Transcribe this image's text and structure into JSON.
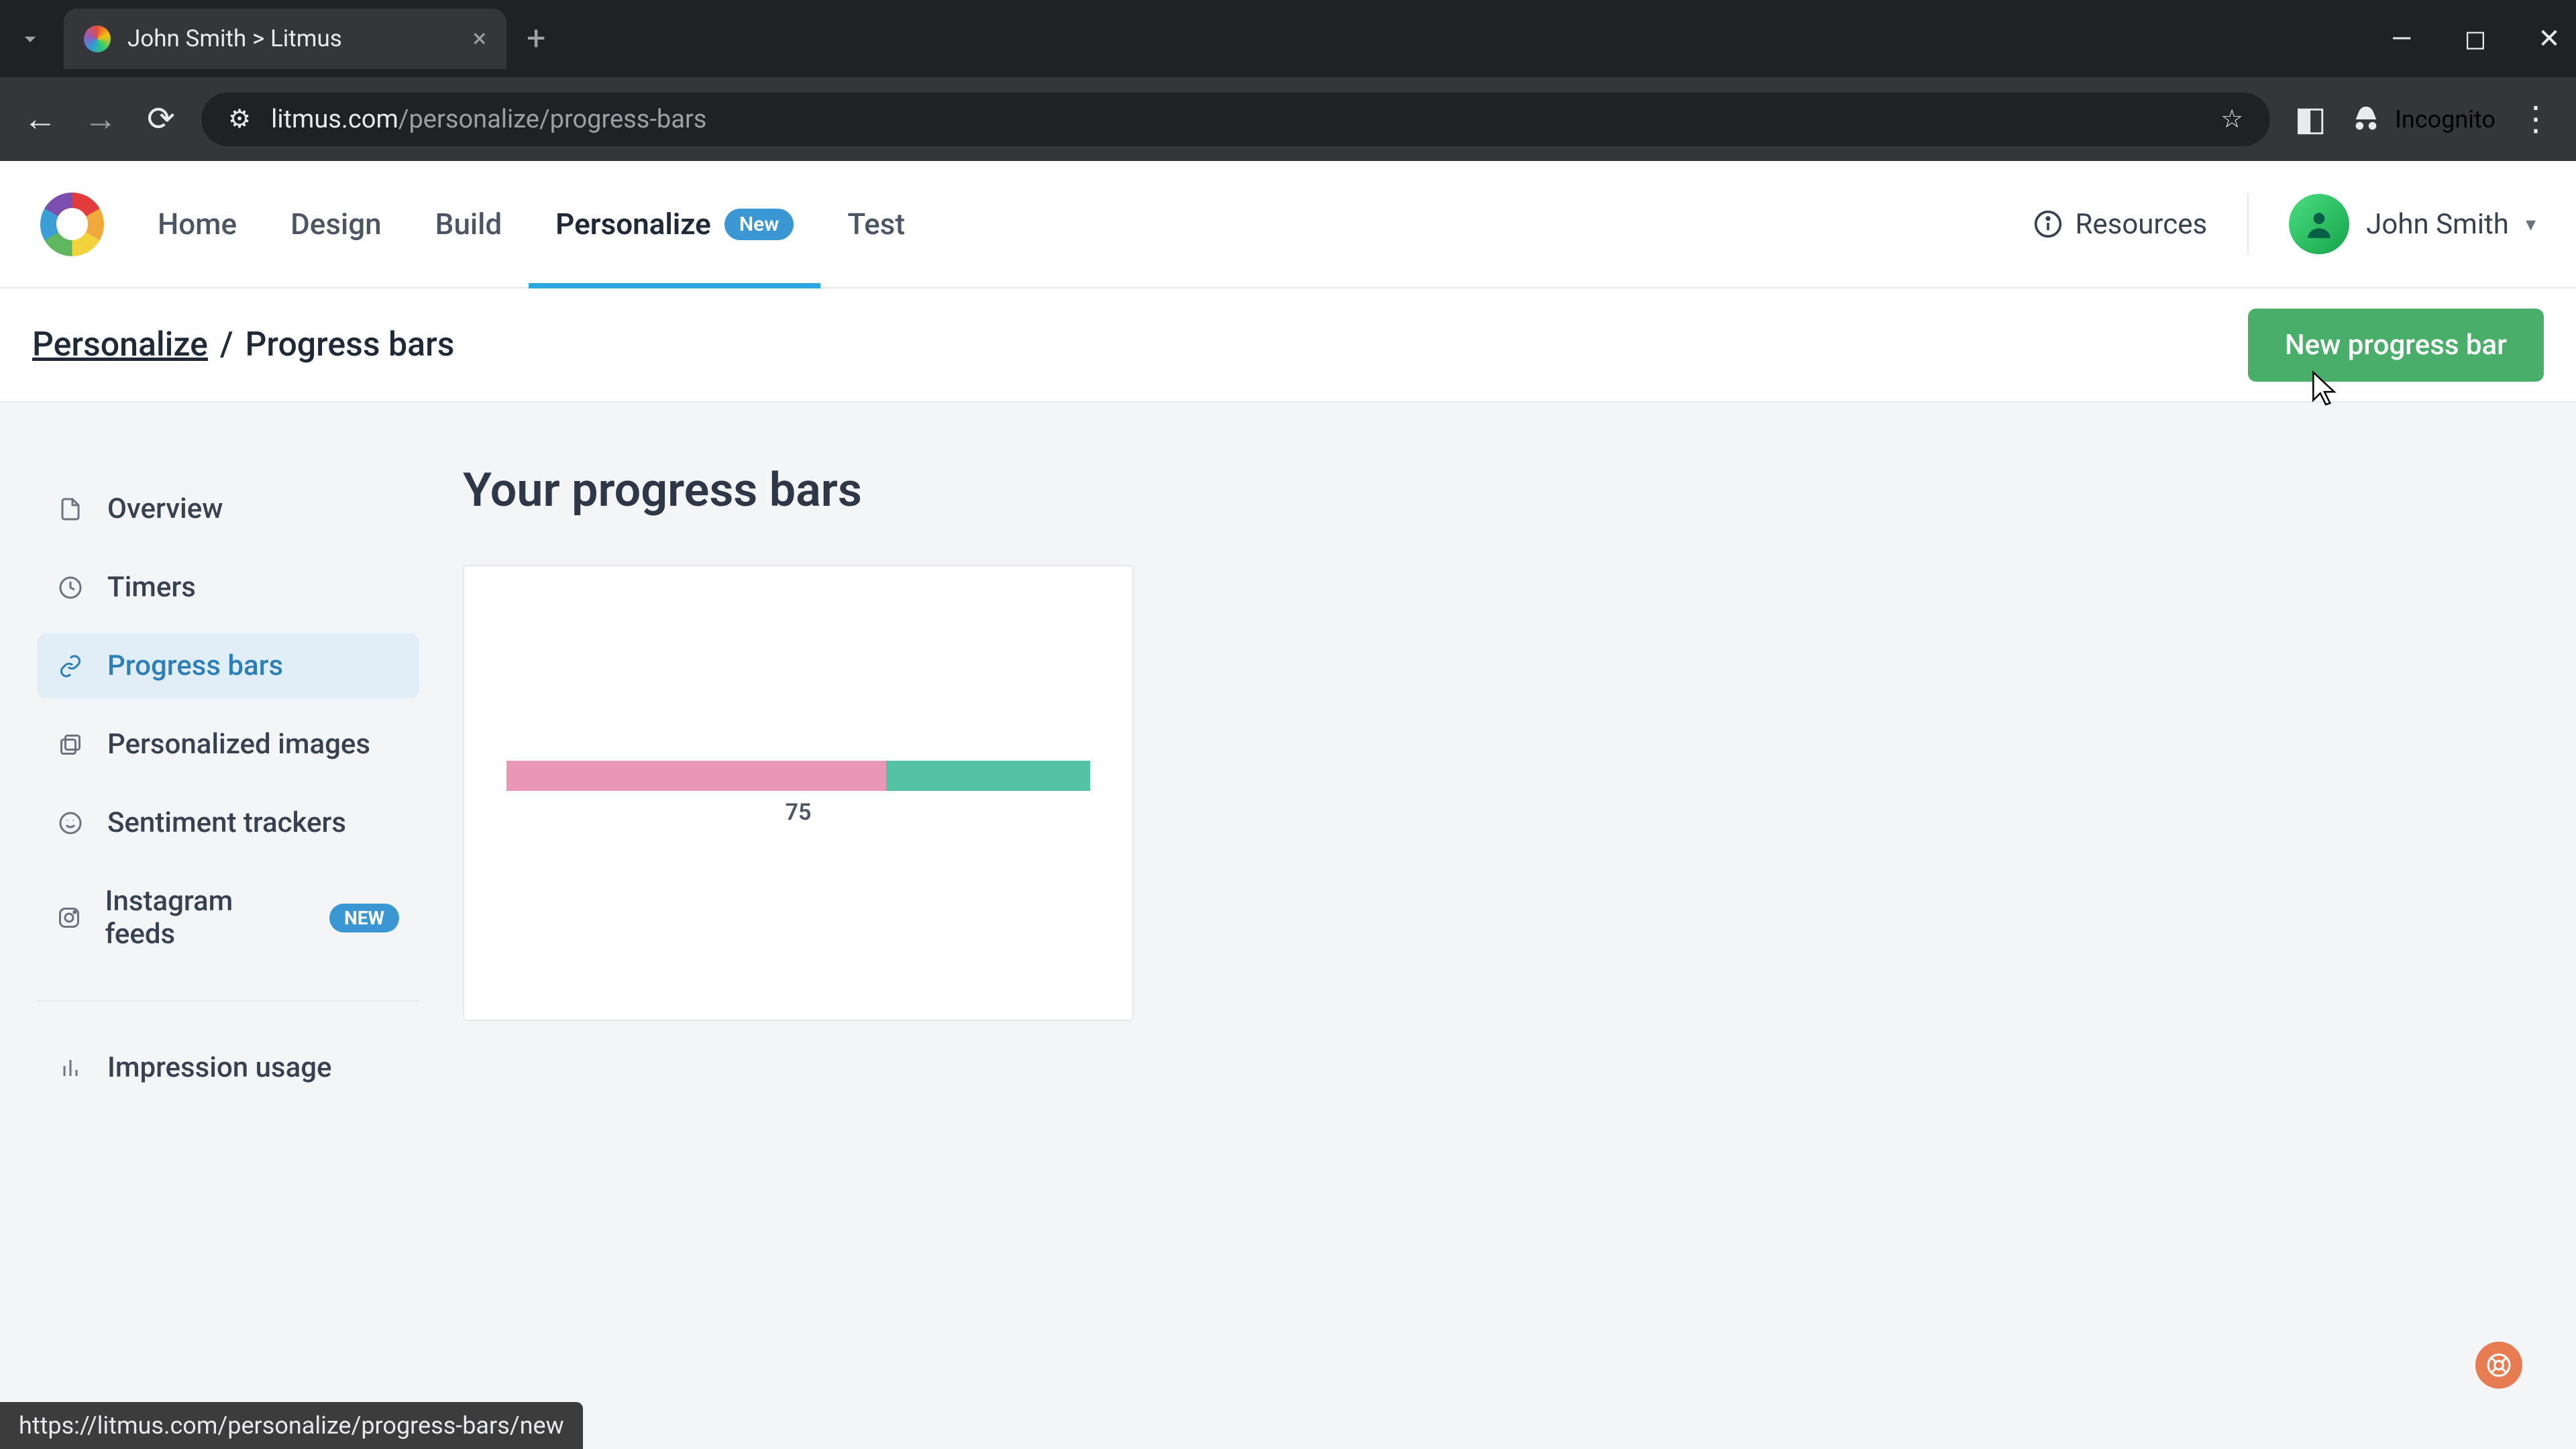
{
  "browser": {
    "tab_title": "John Smith > Litmus",
    "url_host": "litmus.com",
    "url_path": "/personalize/progress-bars",
    "incognito_label": "Incognito",
    "status_url": "https://litmus.com/personalize/progress-bars/new"
  },
  "header": {
    "nav": {
      "home": "Home",
      "design": "Design",
      "build": "Build",
      "personalize": "Personalize",
      "personalize_badge": "New",
      "test": "Test"
    },
    "resources": "Resources",
    "user_name": "John Smith"
  },
  "subheader": {
    "crumb_root": "Personalize",
    "crumb_sep": "/",
    "crumb_current": "Progress bars",
    "new_button": "New progress bar"
  },
  "sidebar": {
    "overview": "Overview",
    "timers": "Timers",
    "progress_bars": "Progress bars",
    "personalized_images": "Personalized images",
    "sentiment_trackers": "Sentiment trackers",
    "instagram_feeds": "Instagram feeds",
    "instagram_badge": "NEW",
    "impression_usage": "Impression usage"
  },
  "content": {
    "heading": "Your progress bars",
    "card_value": "75",
    "bar_pct_a": 65,
    "bar_pct_b": 35
  }
}
